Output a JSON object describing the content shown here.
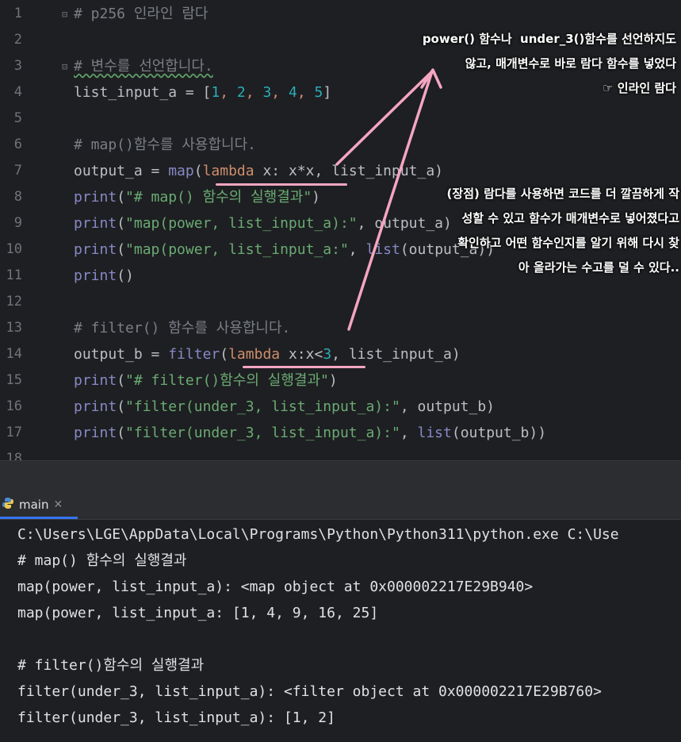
{
  "editor": {
    "line_numbers": [
      "1",
      "2",
      "3",
      "4",
      "5",
      "6",
      "7",
      "8",
      "9",
      "10",
      "11",
      "12",
      "13",
      "14",
      "15",
      "16",
      "17",
      "18"
    ],
    "lines": {
      "l1": "# p256 인라인 람다",
      "l3": "# 변수를 선언합니다.",
      "l4_a": "list_input_a = [",
      "l4_n1": "1",
      "l4_n2": "2",
      "l4_n3": "3",
      "l4_n4": "4",
      "l4_n5": "5",
      "l4_end": "]",
      "l6": "# map()함수를 사용합니다.",
      "l7_a": "output_a = ",
      "l7_map": "map",
      "l7_b": "(",
      "l7_lambda": "lambda",
      "l7_c": " x: x*x, list_input_a)",
      "l8_print": "print",
      "l8_str": "\"# map() 함수의 실행결과\"",
      "l8_end": ")",
      "l9_print": "print",
      "l9_str": "\"map(power, list_input_a):\"",
      "l9_end": ", output_a)",
      "l10_print": "print",
      "l10_str": "\"map(power, list_input_a:\"",
      "l10_mid": ", ",
      "l10_list": "list",
      "l10_end": "(output_a))",
      "l11_print": "print",
      "l11_end": "()",
      "l13": "# filter() 함수를 사용합니다.",
      "l14_a": "output_b = ",
      "l14_filter": "filter",
      "l14_b": "(",
      "l14_lambda": "lambda",
      "l14_c": " x:x<",
      "l14_n": "3",
      "l14_d": ", list_input_a)",
      "l15_print": "print",
      "l15_str": "\"# filter()함수의 실행결과\"",
      "l15_end": ")",
      "l16_print": "print",
      "l16_str": "\"filter(under_3, list_input_a):\"",
      "l16_end": ", output_b)",
      "l17_print": "print",
      "l17_str": "\"filter(under_3, list_input_a):\"",
      "l17_mid": ", ",
      "l17_list": "list",
      "l17_end": "(output_b))"
    }
  },
  "annotations": {
    "top": "power() 함수나  under_3()함수를 선언하지도\n않고, 매개변수로 바로 람다 함수를 넣었다\n☞ 인라인 람다",
    "middle": "(장점) 람다를 사용하면 코드를 더 깔끔하게 작\n성할 수 있고 함수가 매개변수로 넣어졌다고\n확인하고 어떤 함수인지를 알기 위해 다시 찾\n아 올라가는 수고를 덜 수 있다.."
  },
  "run_panel": {
    "tab_label": "main",
    "close_glyph": "✕"
  },
  "console": {
    "lines": [
      "C:\\Users\\LGE\\AppData\\Local\\Programs\\Python\\Python311\\python.exe C:\\Use",
      "# map() 함수의 실행결과",
      "map(power, list_input_a): <map object at 0x000002217E29B940>",
      "map(power, list_input_a: [1, 4, 9, 16, 25]",
      "",
      "# filter()함수의 실행결과",
      "filter(under_3, list_input_a): <filter object at 0x000002217E29B760>",
      "filter(under_3, list_input_a): [1, 2]"
    ]
  },
  "colors": {
    "editor_bg": "#1e1f22",
    "comment": "#7a7e85",
    "string": "#6aab73",
    "keyword": "#cf8e6d",
    "builtin": "#8888c6",
    "number": "#2aacb8",
    "annotation_pink": "#f4a6c0",
    "tab_accent": "#3574f0"
  }
}
